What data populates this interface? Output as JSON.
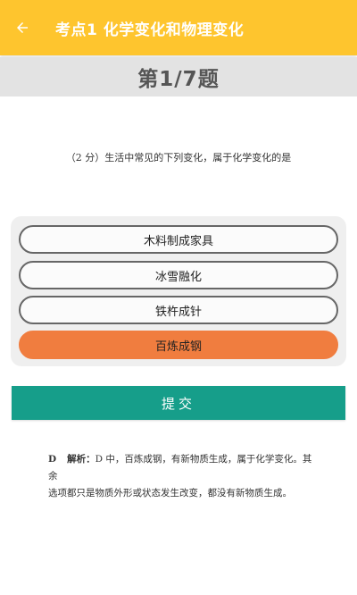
{
  "appbar": {
    "back_icon": "arrow-left-icon",
    "title": "考点1 化学变化和物理变化",
    "background": "#fec52e"
  },
  "counter": {
    "text": "第1/7题"
  },
  "question": {
    "text": "（2 分）生活中常见的下列变化，属于化学变化的是"
  },
  "options": [
    {
      "label": "木料制成家具",
      "selected": false
    },
    {
      "label": "冰雪融化",
      "selected": false
    },
    {
      "label": "铁杵成针",
      "selected": false
    },
    {
      "label": "百炼成钢",
      "selected": true
    }
  ],
  "selected_color": "#f07d3f",
  "submit": {
    "label": "提交",
    "color": "#169e8a"
  },
  "explanation": {
    "answer": "D",
    "label": "解析：",
    "line1": "D 中，百炼成钢，有新物质生成，属于化学变化。其余",
    "line2": "选项都只是物质外形或状态发生改变，都没有新物质生成。"
  }
}
